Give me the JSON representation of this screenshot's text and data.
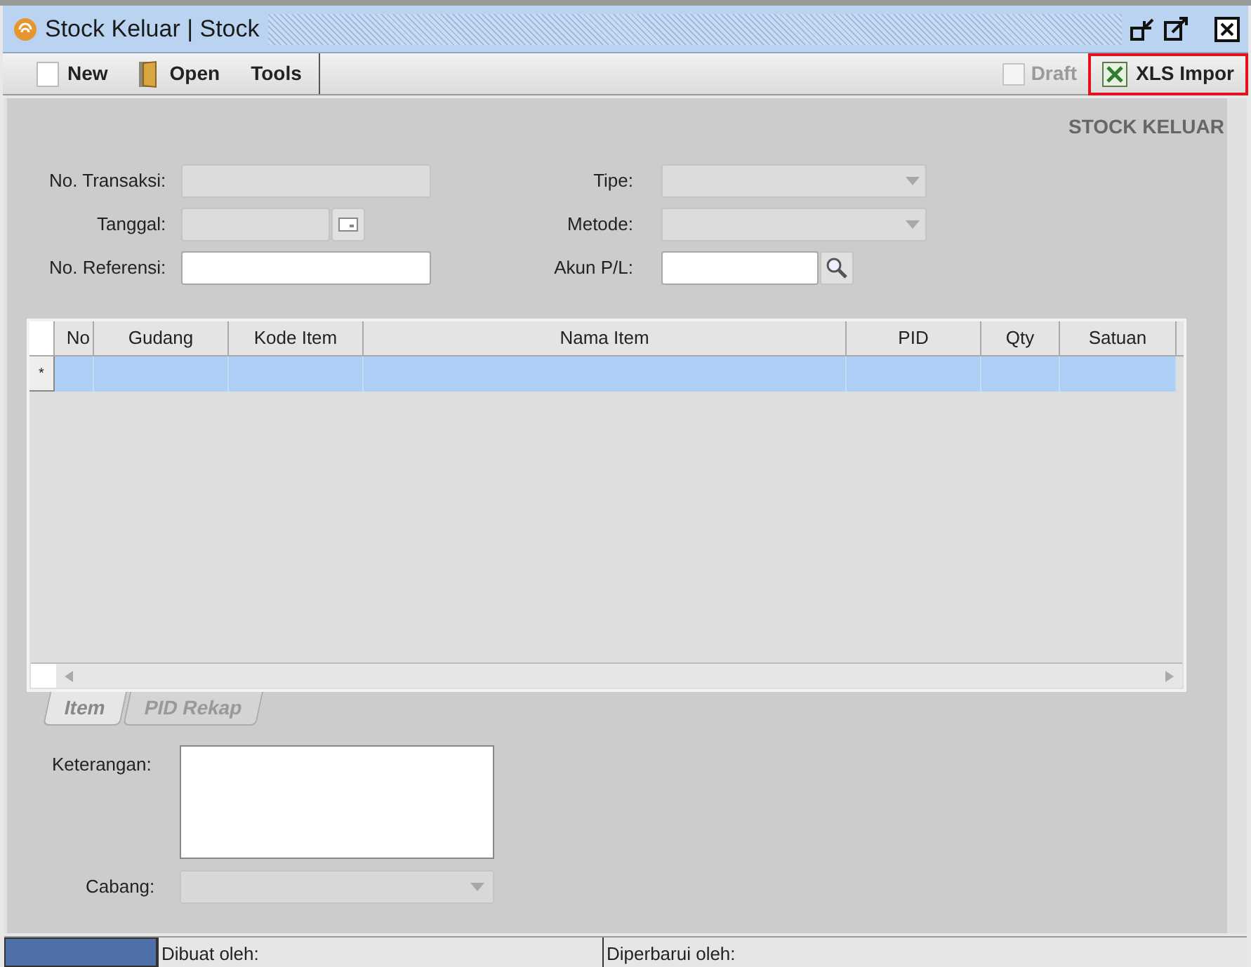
{
  "window": {
    "title": "Stock Keluar | Stock"
  },
  "toolbar": {
    "buttons": [
      {
        "label": "New"
      },
      {
        "label": "Open"
      },
      {
        "label": "Tools"
      }
    ],
    "draft": {
      "label": "Draft",
      "checked": false,
      "disabled": true
    },
    "import": {
      "label": "XLS Impor",
      "highlighted": true
    }
  },
  "heading": "STOCK KELUAR",
  "form": {
    "left": [
      {
        "label": "No. Transaksi:",
        "kind": "text",
        "disabled": true
      },
      {
        "label": "Tanggal:",
        "kind": "date",
        "disabled": true
      },
      {
        "label": "No. Referensi:",
        "kind": "text",
        "disabled": false
      }
    ],
    "right": [
      {
        "label": "Tipe:",
        "kind": "select",
        "disabled": true
      },
      {
        "label": "Metode:",
        "kind": "select",
        "disabled": true
      },
      {
        "label": "Akun P/L:",
        "kind": "lookup",
        "disabled": false
      }
    ]
  },
  "table": {
    "columns": [
      "No",
      "Gudang",
      "Kode Item",
      "Nama Item",
      "PID",
      "Qty",
      "Satuan"
    ],
    "new_row": {
      "marker": "*",
      "selected": true
    }
  },
  "tabs": [
    {
      "label": "Item",
      "selected": true
    },
    {
      "label": "PID Rekap",
      "selected": false
    }
  ],
  "notes": {
    "label": "Keterangan:"
  },
  "branch": {
    "label": "Cabang:",
    "disabled": true
  },
  "status_bar": [
    "Dibuat oleh:",
    "Diperbarui oleh:"
  ]
}
